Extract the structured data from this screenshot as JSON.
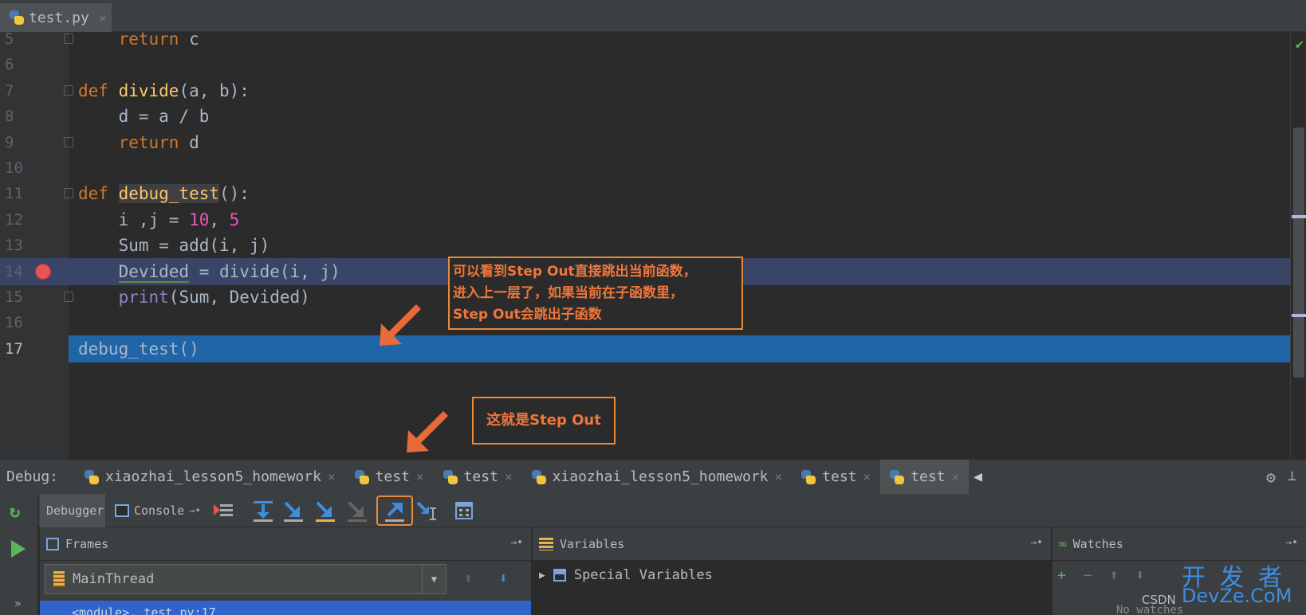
{
  "editor": {
    "file_tab": {
      "name": "test.py",
      "close": "×"
    },
    "lines": [
      {
        "num": "5",
        "tokens": [
          {
            "t": "    ",
            "c": "pl"
          },
          {
            "t": "return",
            "c": "kw"
          },
          {
            "t": " c",
            "c": "pl"
          }
        ]
      },
      {
        "num": "6",
        "tokens": []
      },
      {
        "num": "7",
        "tokens": [
          {
            "t": "def ",
            "c": "kw"
          },
          {
            "t": "divide",
            "c": "fn"
          },
          {
            "t": "(a, b):",
            "c": "pl"
          }
        ]
      },
      {
        "num": "8",
        "tokens": [
          {
            "t": "    d = a / b",
            "c": "pl"
          }
        ]
      },
      {
        "num": "9",
        "tokens": [
          {
            "t": "    ",
            "c": "pl"
          },
          {
            "t": "return",
            "c": "kw"
          },
          {
            "t": " d",
            "c": "pl"
          }
        ]
      },
      {
        "num": "10",
        "tokens": []
      },
      {
        "num": "11",
        "tokens": [
          {
            "t": "def ",
            "c": "kw"
          },
          {
            "t": "debug_test",
            "c": "fn hl"
          },
          {
            "t": "():",
            "c": "pl"
          }
        ]
      },
      {
        "num": "12",
        "tokens": [
          {
            "t": "    i ,j = ",
            "c": "pl"
          },
          {
            "t": "10",
            "c": "num2"
          },
          {
            "t": ", ",
            "c": "pl"
          },
          {
            "t": "5",
            "c": "num2"
          }
        ]
      },
      {
        "num": "13",
        "tokens": [
          {
            "t": "    Sum = add(i, j)",
            "c": "pl"
          }
        ]
      },
      {
        "num": "14",
        "tokens": [
          {
            "t": "    ",
            "c": "pl"
          },
          {
            "t": "Devided",
            "c": "pl underline"
          },
          {
            "t": " = divide(i, j)",
            "c": "pl"
          }
        ]
      },
      {
        "num": "15",
        "tokens": [
          {
            "t": "    ",
            "c": "pl"
          },
          {
            "t": "print",
            "c": "bi"
          },
          {
            "t": "(Sum, Devided)",
            "c": "pl"
          }
        ]
      },
      {
        "num": "16",
        "tokens": []
      },
      {
        "num": "17",
        "tokens": [
          {
            "t": "debug_test()",
            "c": "pl"
          }
        ]
      }
    ],
    "breakpoint_line": "14",
    "execution_line": "17"
  },
  "annotations": {
    "note1": [
      "可以看到Step Out直接跳出当前函数，",
      "进入上一层了，如果当前在子函数里，",
      "Step Out会跳出子函数"
    ],
    "note2": "这就是Step Out"
  },
  "debug": {
    "label": "Debug:",
    "tabs": [
      {
        "name": "xiaozhai_lesson5_homework",
        "active": false
      },
      {
        "name": "test",
        "active": false
      },
      {
        "name": "test",
        "active": false
      },
      {
        "name": "xiaozhai_lesson5_homework",
        "active": false
      },
      {
        "name": "test",
        "active": false
      },
      {
        "name": "test",
        "active": true
      }
    ],
    "subtabs": {
      "debugger": "Debugger",
      "console": "Console"
    },
    "panels": {
      "frames": "Frames",
      "variables": "Variables",
      "watches": "Watches"
    },
    "thread": "MainThread",
    "frame_row": "<module>, test.py:17",
    "special_variables": "Special Variables",
    "no_watches": "No watches"
  },
  "watermark": {
    "csdn": "CSDN",
    "line1": "开发者",
    "line2": "DevZe.CoM"
  },
  "colors": {
    "accent": "#2065a8",
    "breakpoint": "#e65550",
    "annotation": "#f0763c"
  }
}
